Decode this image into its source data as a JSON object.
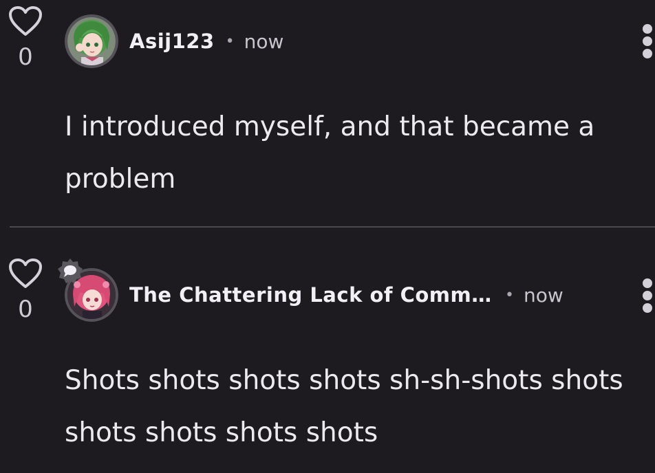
{
  "comments": [
    {
      "likes": "0",
      "username": "Asij123",
      "separator": "•",
      "time": "now",
      "text": "I introduced myself, and that became a problem",
      "avatar_icon": "anime-avatar-green-hair"
    },
    {
      "likes": "0",
      "username": "The Chattering Lack of Comm…",
      "separator": "•",
      "time": "now",
      "text": "Shots shots shots shots sh-sh-shots shots shots shots shots shots",
      "avatar_icon": "anime-avatar-pink-hair",
      "badge_icon": "community-chat-badge-icon"
    }
  ],
  "colors": {
    "background": "#1d1b20",
    "text": "#ece9f0",
    "divider": "#4a474e"
  }
}
